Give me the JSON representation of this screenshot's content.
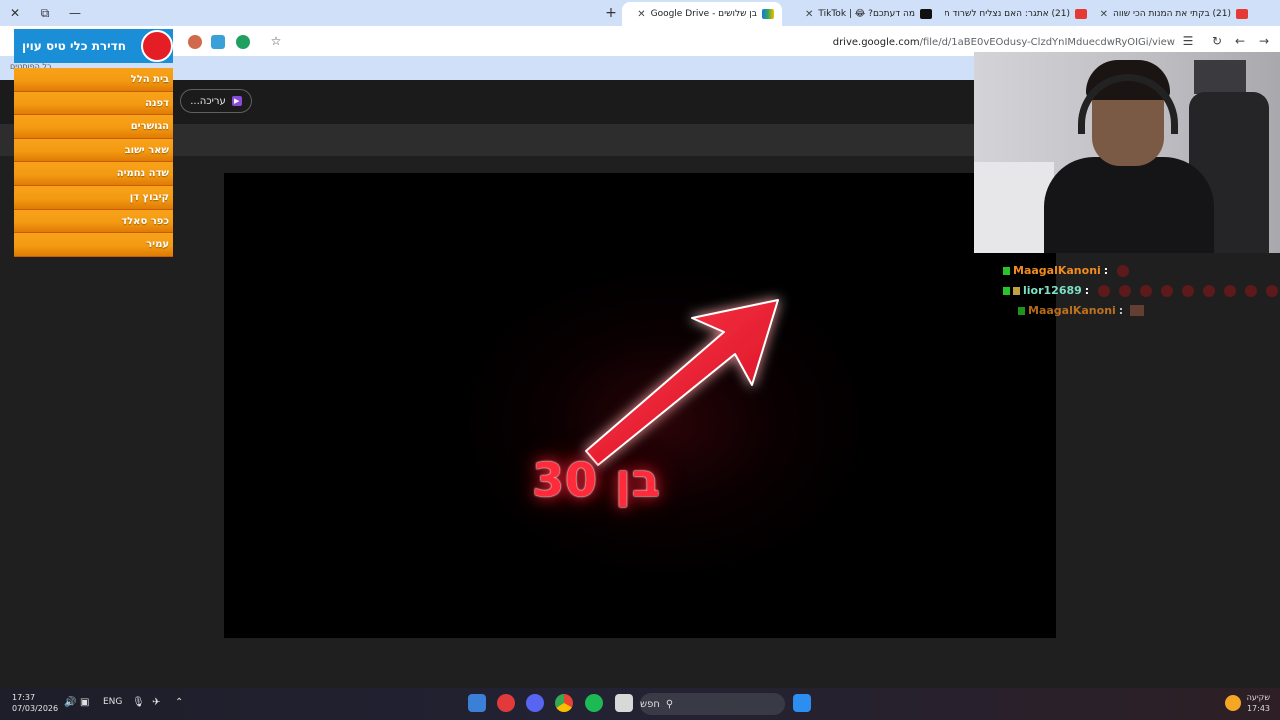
{
  "window_controls": {
    "close": "✕",
    "restore": "⧉",
    "minimize": "—"
  },
  "tabs": [
    {
      "label": "(21) בקתי את המנות הכי שווה",
      "icon": "youtube-icon",
      "color": "#e53935"
    },
    {
      "label": "(21) אתגר: האם נצליח לשרוד ת",
      "icon": "youtube-icon",
      "color": "#e53935"
    },
    {
      "label": "מה דעתכם? 😂 | TikTok",
      "icon": "tiktok-icon",
      "color": "#111111"
    },
    {
      "label": "בן שלושים - Google Drive",
      "icon": "google-drive-icon",
      "color": "#34a853",
      "active": true
    }
  ],
  "new_tab_symbol": "+",
  "address": {
    "host": "drive.google.com",
    "path": "/file/d/1aBE0vEOdusy-ClzdYnIMduecdwRyOIGi/view"
  },
  "drive": {
    "open_with_label": "עריכה..."
  },
  "video": {
    "overlay_text": "בן 30"
  },
  "overlay": {
    "logo_text": "חדירת כלי טיס עוין",
    "sub_text": "כל הפוסטים",
    "locations": [
      "בית הלל",
      "דפנה",
      "הגושרים",
      "שאר ישוב",
      "שדה נחמיה",
      "קיבוץ דן",
      "כפר סאלד",
      "עמיר"
    ]
  },
  "chat": [
    {
      "user": "MaagalKanoni",
      "color": "orange"
    },
    {
      "user": "lior12689",
      "color": "green"
    },
    {
      "user": "MaagalKanoni",
      "color": "orange"
    }
  ],
  "taskbar": {
    "time": "17:37",
    "date": "07/03/2026",
    "lang": "ENG",
    "search_label": "חפש",
    "weather_label": "שקיעה",
    "weather_time": "17:43"
  }
}
